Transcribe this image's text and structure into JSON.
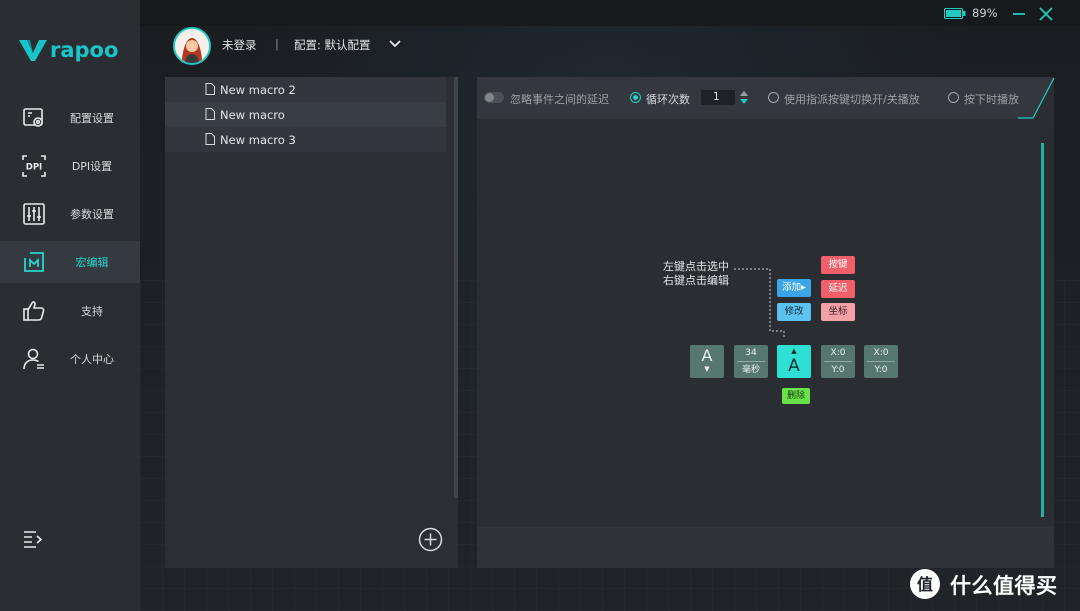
{
  "app": {
    "brand": "rapoo"
  },
  "titlebar": {
    "battery_pct": "89%",
    "accent": "#21c9bd"
  },
  "header": {
    "login_status": "未登录",
    "divider": "|",
    "config_label": "配置: 默认配置"
  },
  "sidebar": {
    "items": [
      {
        "label": "配置设置",
        "icon": "config-settings-icon"
      },
      {
        "label": "DPI设置",
        "icon": "dpi-icon"
      },
      {
        "label": "参数设置",
        "icon": "sliders-icon"
      },
      {
        "label": "宏编辑",
        "icon": "macro-icon",
        "active": true
      },
      {
        "label": "支持",
        "icon": "thumbs-up-icon"
      },
      {
        "label": "个人中心",
        "icon": "user-center-icon"
      }
    ]
  },
  "macros": {
    "items": [
      {
        "label": "New macro 2"
      },
      {
        "label": "New macro"
      },
      {
        "label": "New macro 3"
      }
    ]
  },
  "toolbar": {
    "ignore_delay_label": "忽略事件之间的延迟",
    "loop_label": "循环次数",
    "loop_count": "1",
    "toggle_mode_label": "使用指派按键切换开/关播放",
    "hold_mode_label": "按下时播放"
  },
  "tutorial": {
    "hint_line1": "左键点击选中",
    "hint_line2": "右键点击编辑",
    "add_label": "添加",
    "add_arrow": "▸",
    "modify_label": "修改",
    "key_label": "按键",
    "delay_label": "延迟",
    "coord_label": "坐标",
    "delete_label": "删除",
    "block_key": "A",
    "block_key_arrow": "▼",
    "block_delay_value": "34",
    "block_delay_unit": "毫秒",
    "block_active_key": "A",
    "block_active_arrow": "▲",
    "block_x": "X:0",
    "block_y": "Y:0"
  },
  "watermark": {
    "text": "什么值得买",
    "logo_glyph": "值"
  }
}
